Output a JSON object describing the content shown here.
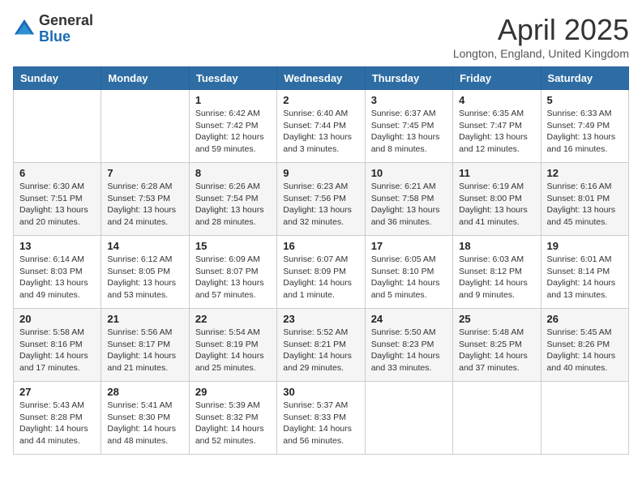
{
  "logo": {
    "general": "General",
    "blue": "Blue"
  },
  "title": "April 2025",
  "location": "Longton, England, United Kingdom",
  "weekdays": [
    "Sunday",
    "Monday",
    "Tuesday",
    "Wednesday",
    "Thursday",
    "Friday",
    "Saturday"
  ],
  "weeks": [
    [
      {
        "day": null
      },
      {
        "day": null
      },
      {
        "day": 1,
        "sunrise": "6:42 AM",
        "sunset": "7:42 PM",
        "daylight": "12 hours and 59 minutes."
      },
      {
        "day": 2,
        "sunrise": "6:40 AM",
        "sunset": "7:44 PM",
        "daylight": "13 hours and 3 minutes."
      },
      {
        "day": 3,
        "sunrise": "6:37 AM",
        "sunset": "7:45 PM",
        "daylight": "13 hours and 8 minutes."
      },
      {
        "day": 4,
        "sunrise": "6:35 AM",
        "sunset": "7:47 PM",
        "daylight": "13 hours and 12 minutes."
      },
      {
        "day": 5,
        "sunrise": "6:33 AM",
        "sunset": "7:49 PM",
        "daylight": "13 hours and 16 minutes."
      }
    ],
    [
      {
        "day": 6,
        "sunrise": "6:30 AM",
        "sunset": "7:51 PM",
        "daylight": "13 hours and 20 minutes."
      },
      {
        "day": 7,
        "sunrise": "6:28 AM",
        "sunset": "7:53 PM",
        "daylight": "13 hours and 24 minutes."
      },
      {
        "day": 8,
        "sunrise": "6:26 AM",
        "sunset": "7:54 PM",
        "daylight": "13 hours and 28 minutes."
      },
      {
        "day": 9,
        "sunrise": "6:23 AM",
        "sunset": "7:56 PM",
        "daylight": "13 hours and 32 minutes."
      },
      {
        "day": 10,
        "sunrise": "6:21 AM",
        "sunset": "7:58 PM",
        "daylight": "13 hours and 36 minutes."
      },
      {
        "day": 11,
        "sunrise": "6:19 AM",
        "sunset": "8:00 PM",
        "daylight": "13 hours and 41 minutes."
      },
      {
        "day": 12,
        "sunrise": "6:16 AM",
        "sunset": "8:01 PM",
        "daylight": "13 hours and 45 minutes."
      }
    ],
    [
      {
        "day": 13,
        "sunrise": "6:14 AM",
        "sunset": "8:03 PM",
        "daylight": "13 hours and 49 minutes."
      },
      {
        "day": 14,
        "sunrise": "6:12 AM",
        "sunset": "8:05 PM",
        "daylight": "13 hours and 53 minutes."
      },
      {
        "day": 15,
        "sunrise": "6:09 AM",
        "sunset": "8:07 PM",
        "daylight": "13 hours and 57 minutes."
      },
      {
        "day": 16,
        "sunrise": "6:07 AM",
        "sunset": "8:09 PM",
        "daylight": "14 hours and 1 minute."
      },
      {
        "day": 17,
        "sunrise": "6:05 AM",
        "sunset": "8:10 PM",
        "daylight": "14 hours and 5 minutes."
      },
      {
        "day": 18,
        "sunrise": "6:03 AM",
        "sunset": "8:12 PM",
        "daylight": "14 hours and 9 minutes."
      },
      {
        "day": 19,
        "sunrise": "6:01 AM",
        "sunset": "8:14 PM",
        "daylight": "14 hours and 13 minutes."
      }
    ],
    [
      {
        "day": 20,
        "sunrise": "5:58 AM",
        "sunset": "8:16 PM",
        "daylight": "14 hours and 17 minutes."
      },
      {
        "day": 21,
        "sunrise": "5:56 AM",
        "sunset": "8:17 PM",
        "daylight": "14 hours and 21 minutes."
      },
      {
        "day": 22,
        "sunrise": "5:54 AM",
        "sunset": "8:19 PM",
        "daylight": "14 hours and 25 minutes."
      },
      {
        "day": 23,
        "sunrise": "5:52 AM",
        "sunset": "8:21 PM",
        "daylight": "14 hours and 29 minutes."
      },
      {
        "day": 24,
        "sunrise": "5:50 AM",
        "sunset": "8:23 PM",
        "daylight": "14 hours and 33 minutes."
      },
      {
        "day": 25,
        "sunrise": "5:48 AM",
        "sunset": "8:25 PM",
        "daylight": "14 hours and 37 minutes."
      },
      {
        "day": 26,
        "sunrise": "5:45 AM",
        "sunset": "8:26 PM",
        "daylight": "14 hours and 40 minutes."
      }
    ],
    [
      {
        "day": 27,
        "sunrise": "5:43 AM",
        "sunset": "8:28 PM",
        "daylight": "14 hours and 44 minutes."
      },
      {
        "day": 28,
        "sunrise": "5:41 AM",
        "sunset": "8:30 PM",
        "daylight": "14 hours and 48 minutes."
      },
      {
        "day": 29,
        "sunrise": "5:39 AM",
        "sunset": "8:32 PM",
        "daylight": "14 hours and 52 minutes."
      },
      {
        "day": 30,
        "sunrise": "5:37 AM",
        "sunset": "8:33 PM",
        "daylight": "14 hours and 56 minutes."
      },
      {
        "day": null
      },
      {
        "day": null
      },
      {
        "day": null
      }
    ]
  ]
}
